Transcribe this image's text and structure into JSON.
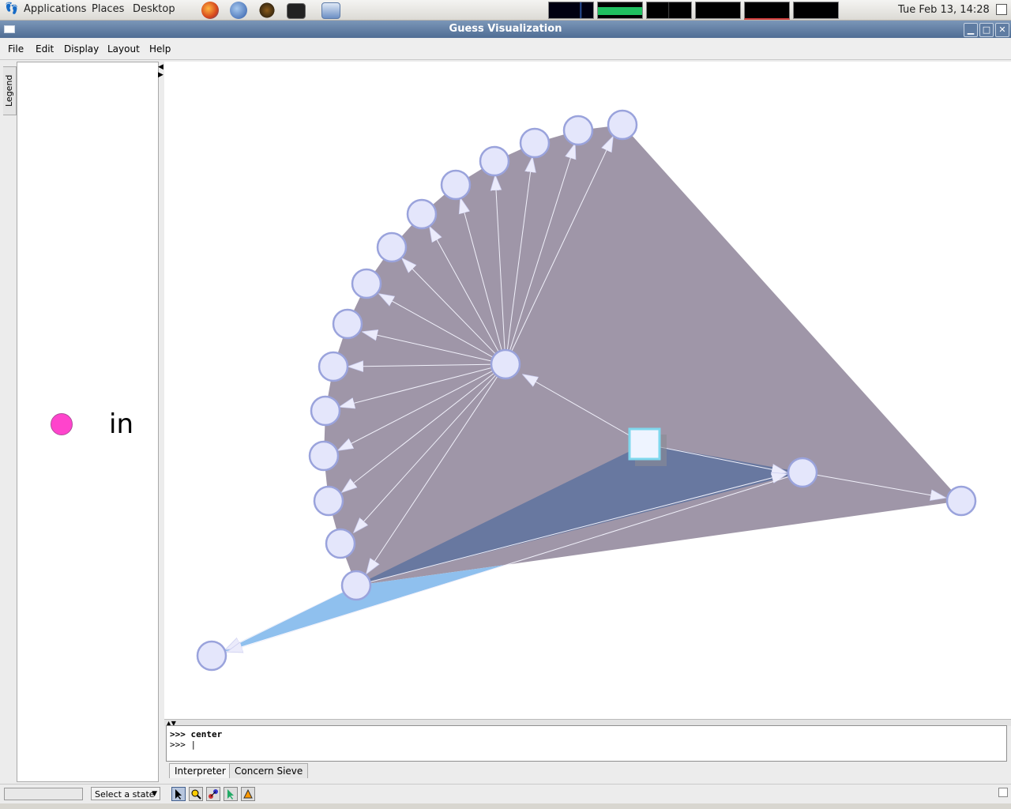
{
  "panel": {
    "menus": [
      "Applications",
      "Places",
      "Desktop"
    ],
    "clock": "Tue Feb 13, 14:28"
  },
  "window": {
    "title": "Guess Visualization",
    "controls": [
      "minimize",
      "maximize",
      "close"
    ]
  },
  "menubar": [
    "File",
    "Edit",
    "Display",
    "Layout",
    "Help"
  ],
  "legend": {
    "tab_label": "Legend",
    "entries": [
      {
        "label": "in",
        "color": "#ff44cc"
      }
    ]
  },
  "interpreter": {
    "lines": [
      ">>> center",
      ">>> |"
    ],
    "tabs": [
      "Interpreter",
      "Concern Sieve"
    ]
  },
  "statusbar": {
    "state_select": "Select a state"
  },
  "colors": {
    "node_fill": "#e4e6fb",
    "node_stroke": "#9aa3dc",
    "hull_gray": "#9f96a8",
    "hull_blue": "#6878a0",
    "hull_lightblue": "#8fc0ee",
    "center_square": "#eef4ff"
  }
}
